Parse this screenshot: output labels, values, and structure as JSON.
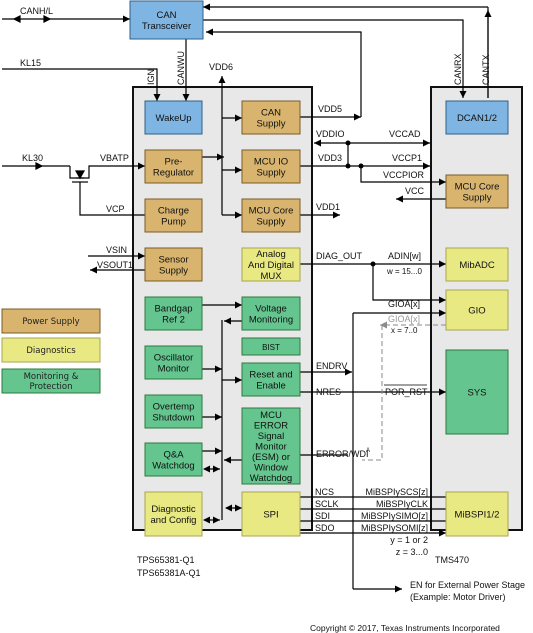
{
  "colors": {
    "power_supply": "#d8b46e",
    "power_supply_border": "#7a5c26",
    "diagnostics": "#e9e984",
    "diagnostics_border": "#a8a650",
    "monitoring": "#64c58f",
    "monitoring_border": "#2d7a3e",
    "communication": "#7fb5e3",
    "communication_border": "#2f5f88",
    "chip_fill": "#e8e8e8",
    "chip_border": "#111111",
    "dashed_line": "#8a8a8a"
  },
  "chips": {
    "tps": {
      "label_line1": "TPS65381-Q1",
      "label_line2": "TPS65381A-Q1"
    },
    "tms": {
      "label": "TMS470"
    }
  },
  "blocks": {
    "can_transceiver": [
      "CAN",
      "Transceiver"
    ],
    "wakeup": [
      "WakeUp"
    ],
    "can_supply": [
      "CAN",
      "Supply"
    ],
    "pre_regulator": [
      "Pre-",
      "Regulator"
    ],
    "mcu_io_supply": [
      "MCU IO",
      "Supply"
    ],
    "charge_pump": [
      "Charge",
      "Pump"
    ],
    "mcu_core_supply_tps": [
      "MCU Core",
      "Supply"
    ],
    "sensor_supply": [
      "Sensor",
      "Supply"
    ],
    "analog_digital_mux": [
      "Analog",
      "And Digital",
      "MUX"
    ],
    "bandgap_ref": [
      "Bandgap",
      "Ref 2"
    ],
    "voltage_monitoring": [
      "Voltage",
      "Monitoring"
    ],
    "bist": [
      "BIST"
    ],
    "oscillator_monitor": [
      "Oscillator",
      "Monitor"
    ],
    "reset_enable": [
      "Reset and",
      "Enable"
    ],
    "overtemp_shutdown": [
      "Overtemp",
      "Shutdown"
    ],
    "esm": [
      "MCU",
      "ERROR",
      "Signal",
      "Monitor",
      "(ESM) or",
      "Window",
      "Watchdog"
    ],
    "qa_watchdog": [
      "Q&A",
      "Watchdog"
    ],
    "diagnostic_config": [
      "Diagnostic",
      "and Config"
    ],
    "spi": [
      "SPI"
    ],
    "dcan": [
      "DCAN1/2"
    ],
    "mcu_core_supply_tms": [
      "MCU Core",
      "Supply"
    ],
    "mibadc": [
      "MibADC"
    ],
    "gio": [
      "GIO"
    ],
    "sys": [
      "SYS"
    ],
    "mibspi": [
      "MiBSPI1/2"
    ]
  },
  "signals": {
    "canhl": "CANH/L",
    "kl15": "KL15",
    "ign": "IGN",
    "canwu": "CANWU",
    "vdd6": "VDD6",
    "kl30": "KL30",
    "vbatp": "VBATP",
    "vcp": "VCP",
    "vsin": "VSIN",
    "vsout1": "VSOUT1",
    "canrx": "CANRX",
    "cantx": "CANTX",
    "vdd5": "VDD5",
    "vddio": "VDDIO",
    "vccad": "VCCAD",
    "vdd3": "VDD3",
    "vccp1": "VCCP1",
    "vccpior": "VCCPIOR",
    "vcc": "VCC",
    "vdd1": "VDD1",
    "diag_out": "DIAG_OUT",
    "adin": "ADIN[w]",
    "w_range": "w = 15...0",
    "gioa_x": "GIOA[x]",
    "gioa_x_dashed": "GIOA[x]",
    "x_range": "x = 7..0",
    "endrv": "ENDRV",
    "nres": "NRES",
    "por_rst": "POR_RST",
    "error_wdi": "ERROR/WDI",
    "error_wdi_sup": "A",
    "ncs": "NCS",
    "sclk": "SCLK",
    "sdi": "SDI",
    "sdo": "SDO",
    "mibspi_scs": "MiBSPIySCS[z]",
    "mibspi_clk": "MiBSPIyCLK",
    "mibspi_simo": "MiBSPIySIMO[z]",
    "mibspi_somi": "MiBSPIySOMI[z]",
    "y_range": "y = 1 or 2",
    "z_range": "z = 3...0"
  },
  "external": {
    "en_line1": "EN for External Power Stage",
    "en_line2": "(Example: Motor Driver)"
  },
  "legend": [
    {
      "label_lines": [
        "Power Supply"
      ],
      "category": "power_supply"
    },
    {
      "label_lines": [
        "Diagnostics"
      ],
      "category": "diagnostics"
    },
    {
      "label_lines": [
        "Monitoring &",
        "Protection"
      ],
      "category": "monitoring"
    }
  ],
  "copyright": "Copyright © 2017, Texas Instruments Incorporated"
}
